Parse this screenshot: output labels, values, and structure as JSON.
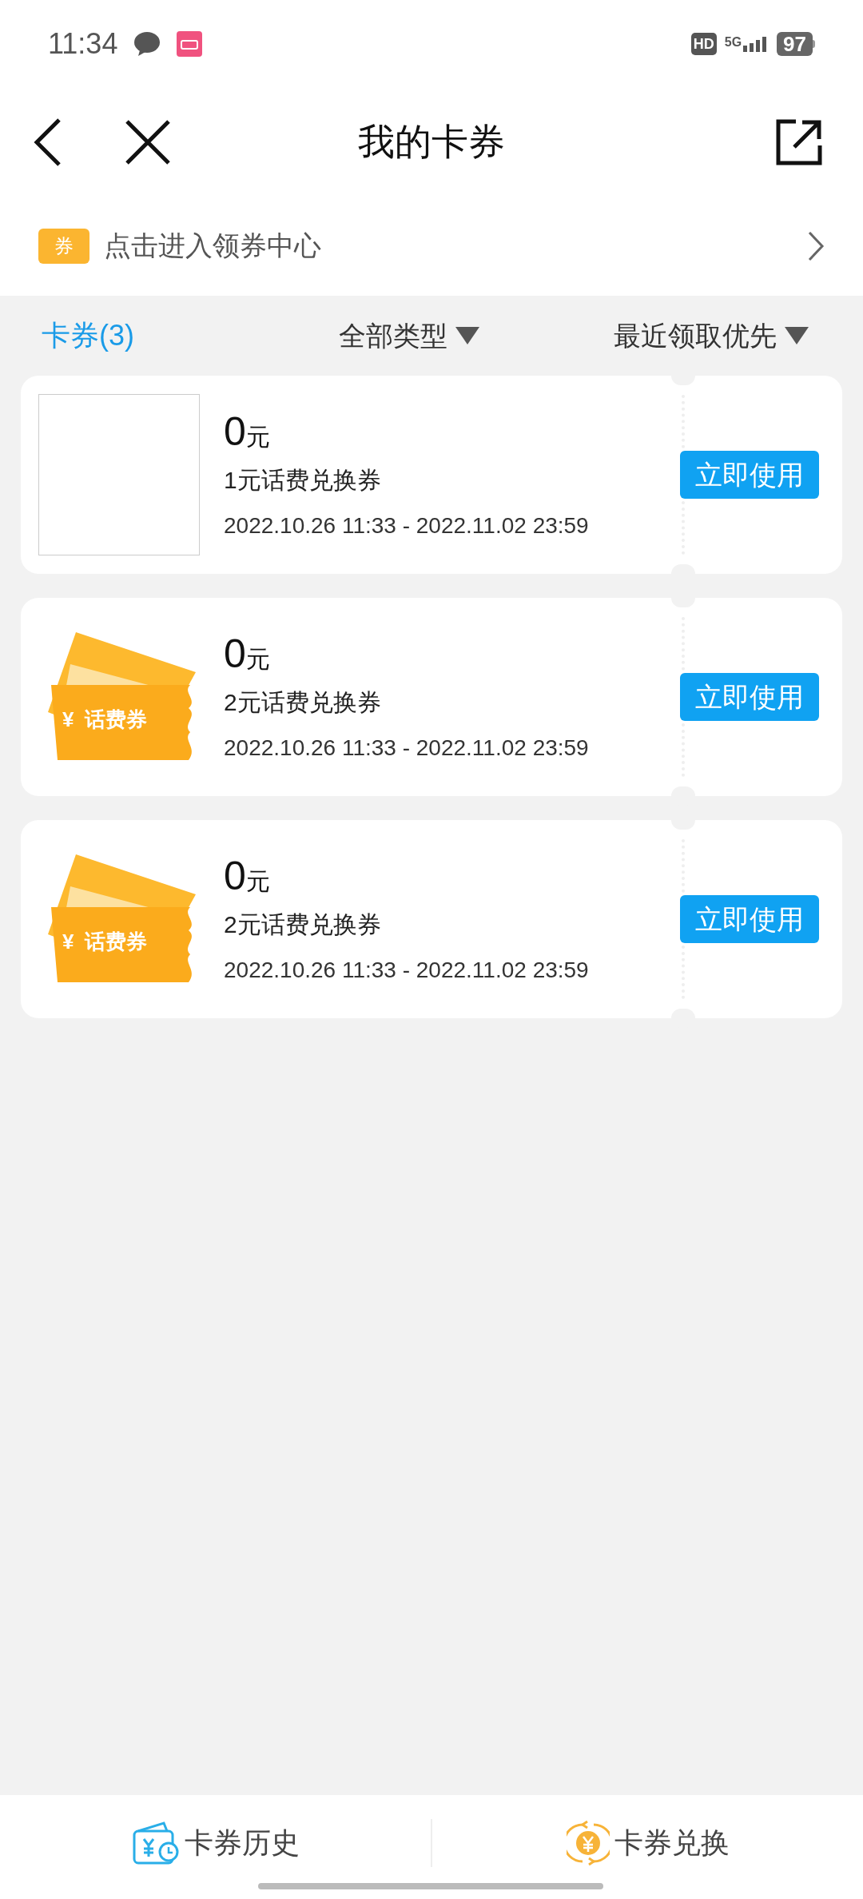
{
  "status_bar": {
    "time": "11:34",
    "battery": "97",
    "network": "5G",
    "hd": "HD"
  },
  "header": {
    "title": "我的卡券"
  },
  "banner": {
    "icon_text": "券",
    "text": "点击进入领券中心"
  },
  "filters": {
    "count_tab": {
      "label": "卡券(3)",
      "selected": true
    },
    "type_filter": "全部类型",
    "sort_filter": "最近领取优先"
  },
  "coupons": [
    {
      "image": {
        "kind": "blank"
      },
      "amount": "0",
      "unit": "元",
      "name": "1元话费兑换券",
      "validity": "2022.10.26 11:33 - 2022.11.02 23:59",
      "button": "立即使用"
    },
    {
      "image": {
        "kind": "ticket",
        "symbol": "¥",
        "label": "话费券"
      },
      "amount": "0",
      "unit": "元",
      "name": "2元话费兑换券",
      "validity": "2022.10.26 11:33 - 2022.11.02 23:59",
      "button": "立即使用"
    },
    {
      "image": {
        "kind": "ticket",
        "symbol": "¥",
        "label": "话费券"
      },
      "amount": "0",
      "unit": "元",
      "name": "2元话费兑换券",
      "validity": "2022.10.26 11:33 - 2022.11.02 23:59",
      "button": "立即使用"
    }
  ],
  "bottom_bar": [
    {
      "kind": "history",
      "label": "卡券历史"
    },
    {
      "kind": "exchange",
      "label": "卡券兑换"
    }
  ]
}
